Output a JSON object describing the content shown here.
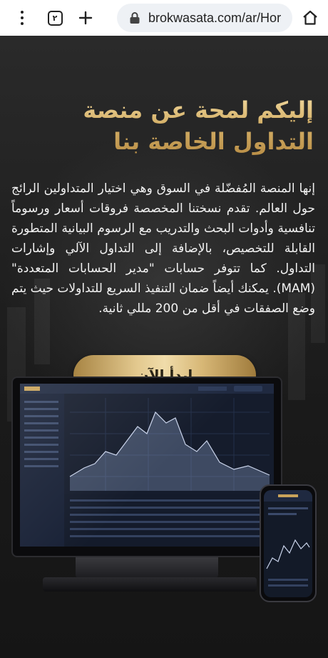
{
  "browser": {
    "tab_count": "٢",
    "url": "brokwasata.com/ar/Hor"
  },
  "hero": {
    "headline_line1": "إليكم لمحة عن منصة",
    "headline_line2": "التداول الخاصة بنا",
    "body": "إنها المنصة المُفضّلة في السوق وهي اختيار المتداولين الرائج حول العالم. تقدم نسختنا المخصصة فروقات أسعار ورسوماً تنافسية وأدوات البحث والتدريب مع الرسوم البيانية المتطورة القابلة للتخصيص، بالإضافة إلى التداول الآلي وإشارات التداول. كما تتوفر حسابات \"مدير الحسابات المتعددة\" (MAM). يمكنك أيضاً ضمان التنفيذ السريع للتداولات حيث يتم وضع الصفقات في أقل من 200 مللي ثانية.",
    "cta_label": "إبدأ الآن"
  },
  "icons": {
    "menu": "kebab-menu-icon",
    "tabs": "tabs-icon",
    "new_tab": "plus-icon",
    "lock": "lock-icon",
    "home": "home-icon"
  },
  "colors": {
    "gold": "#d6b26a",
    "background": "#1b1b1b",
    "body_text": "#f2f2f2"
  }
}
